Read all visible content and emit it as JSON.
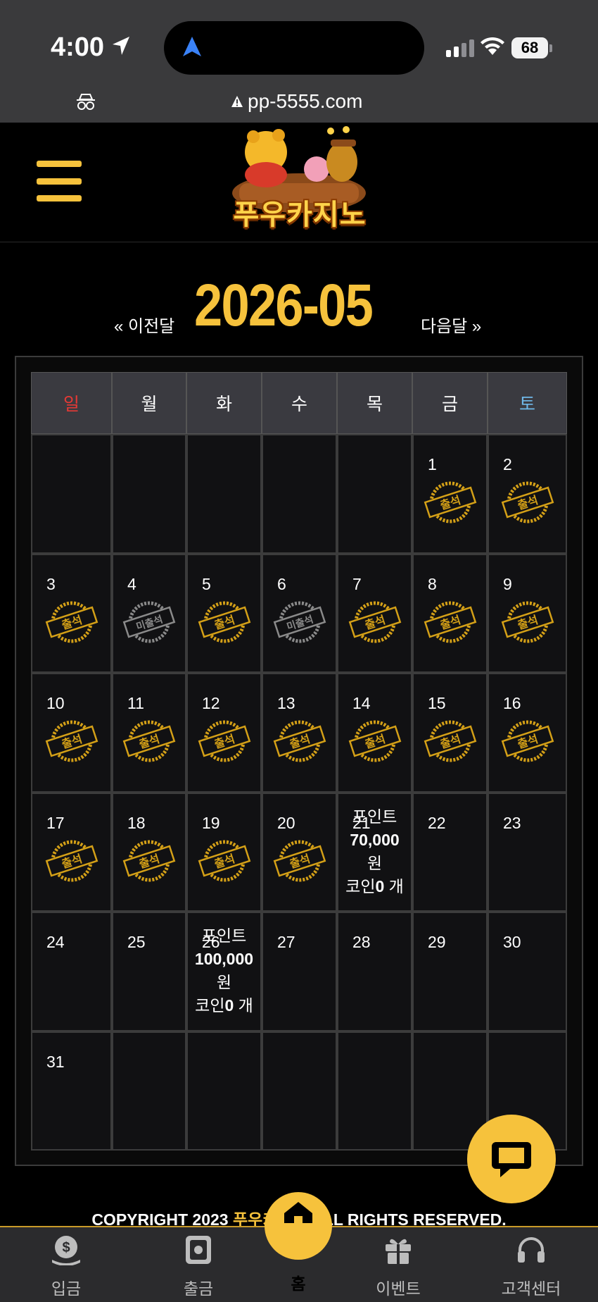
{
  "status_bar": {
    "time": "4:00",
    "battery": "68"
  },
  "browser": {
    "url": "pp-5555.com"
  },
  "header": {
    "logo_text": "푸우카지노"
  },
  "calendar": {
    "prev_label": "« 이전달",
    "month": "2026-05",
    "next_label": "다음달 »",
    "weekdays": [
      "일",
      "월",
      "화",
      "수",
      "목",
      "금",
      "토"
    ],
    "stamp_present": "출석",
    "stamp_absent": "미출석",
    "weeks": [
      [
        {
          "day": "",
          "stamp": ""
        },
        {
          "day": "",
          "stamp": ""
        },
        {
          "day": "",
          "stamp": ""
        },
        {
          "day": "",
          "stamp": ""
        },
        {
          "day": "",
          "stamp": ""
        },
        {
          "day": "1",
          "stamp": "present"
        },
        {
          "day": "2",
          "stamp": "present"
        }
      ],
      [
        {
          "day": "3",
          "stamp": "present"
        },
        {
          "day": "4",
          "stamp": "absent"
        },
        {
          "day": "5",
          "stamp": "present"
        },
        {
          "day": "6",
          "stamp": "absent"
        },
        {
          "day": "7",
          "stamp": "present"
        },
        {
          "day": "8",
          "stamp": "present"
        },
        {
          "day": "9",
          "stamp": "present"
        }
      ],
      [
        {
          "day": "10",
          "stamp": "present"
        },
        {
          "day": "11",
          "stamp": "present"
        },
        {
          "day": "12",
          "stamp": "present"
        },
        {
          "day": "13",
          "stamp": "present"
        },
        {
          "day": "14",
          "stamp": "present"
        },
        {
          "day": "15",
          "stamp": "present"
        },
        {
          "day": "16",
          "stamp": "present"
        }
      ],
      [
        {
          "day": "17",
          "stamp": "present"
        },
        {
          "day": "18",
          "stamp": "present"
        },
        {
          "day": "19",
          "stamp": "present"
        },
        {
          "day": "20",
          "stamp": "present"
        },
        {
          "day": "21",
          "stamp": "",
          "reward": {
            "point_label": "포인트",
            "points": "70,000",
            "won": "원",
            "coin_label": "코인",
            "coins": "0",
            "unit": "개"
          }
        },
        {
          "day": "22",
          "stamp": ""
        },
        {
          "day": "23",
          "stamp": ""
        }
      ],
      [
        {
          "day": "24",
          "stamp": ""
        },
        {
          "day": "25",
          "stamp": ""
        },
        {
          "day": "26",
          "stamp": "",
          "reward": {
            "point_label": "포인트",
            "points": "100,000",
            "won": "원",
            "coin_label": "코인",
            "coins": "0",
            "unit": "개"
          }
        },
        {
          "day": "27",
          "stamp": ""
        },
        {
          "day": "28",
          "stamp": ""
        },
        {
          "day": "29",
          "stamp": ""
        },
        {
          "day": "30",
          "stamp": ""
        }
      ],
      [
        {
          "day": "31",
          "stamp": ""
        },
        {
          "day": "",
          "stamp": ""
        },
        {
          "day": "",
          "stamp": ""
        },
        {
          "day": "",
          "stamp": ""
        },
        {
          "day": "",
          "stamp": ""
        },
        {
          "day": "",
          "stamp": ""
        },
        {
          "day": "",
          "stamp": ""
        }
      ]
    ]
  },
  "footer": {
    "copyright_prefix": "COPYRIGHT 2023 ",
    "copyright_brand": "푸우카지노",
    "copyright_suffix": " ALL RIGHTS RESERVED."
  },
  "bottom_nav": {
    "deposit": "입금",
    "withdraw": "출금",
    "home": "홈",
    "event": "이벤트",
    "support": "고객센터"
  },
  "colors": {
    "accent": "#f6c23c",
    "sunday": "#e53935",
    "saturday": "#6fb8e8",
    "stamp_gold": "#d4a017",
    "stamp_grey": "#8a8a8a"
  }
}
